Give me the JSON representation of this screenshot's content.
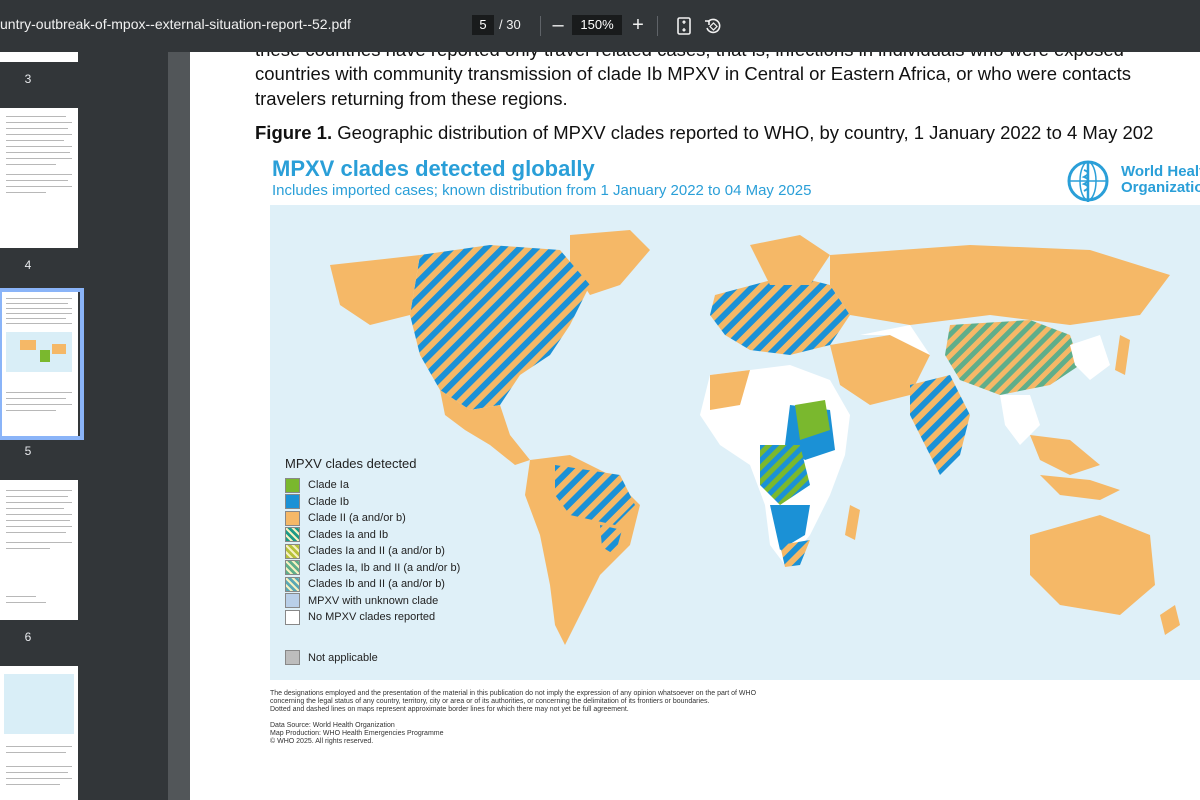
{
  "toolbar": {
    "file_title": "untry-outbreak-of-mpox--external-situation-report--52.pdf",
    "current_page": "5",
    "page_total": "/ 30",
    "zoom": "150%",
    "minus_label": "–",
    "plus_label": "+"
  },
  "sidebar": {
    "thumbnails": [
      {
        "label": "3"
      },
      {
        "label": "4"
      },
      {
        "label": "5"
      },
      {
        "label": "6"
      }
    ]
  },
  "document": {
    "line1": "these countries have reported only travel-related cases, that is, infections in individuals who were exposed",
    "line2": "countries with community transmission of clade Ib MPXV in Central or Eastern Africa, or who were contacts",
    "line3": "travelers returning from these regions.",
    "figure_label": "Figure 1.",
    "figure_caption": " Geographic distribution of MPXV clades reported to WHO, by country, 1 January 2022 to 4 May 202"
  },
  "map": {
    "title": "MPXV clades detected globally",
    "subtitle": "Includes imported cases; known distribution from 1 January 2022 to 04 May 2025",
    "who_line1": "World Health",
    "who_line2": "Organization",
    "legend_title": "MPXV clades detected",
    "legend": [
      {
        "label": "Clade Ia",
        "color": "#7ab82e"
      },
      {
        "label": "Clade Ib",
        "color": "#1b91d6"
      },
      {
        "label": "Clade II (a and/or b)",
        "color": "#f5b867"
      },
      {
        "label": "Clades Ia and Ib",
        "color": "#1d9a87"
      },
      {
        "label": "Clades Ia and II (a and/or b)",
        "color": "#b7c13a"
      },
      {
        "label": "Clades Ia, Ib and II (a and/or b)",
        "color": "#5fae8a"
      },
      {
        "label": "Clades Ib and II (a and/or b)",
        "color": "#5aa8b4"
      },
      {
        "label": "MPXV with unknown clade",
        "color": "#b9cfe8"
      },
      {
        "label": "No MPXV clades reported",
        "color": "#ffffff"
      }
    ],
    "not_applicable": {
      "label": "Not applicable",
      "color": "#bdbdbd"
    },
    "disclaimer": [
      "The designations employed and the presentation of the material in this publication do not imply the expression of any opinion whatsoever on the part of WHO",
      "concerning the legal status of any country, territory, city or area or of its authorities, or concerning the delimitation of its frontiers or boundaries.",
      "Dotted and dashed lines on maps represent approximate border lines for which there may not yet be full agreement.",
      "",
      "Data Source: World Health Organization",
      "Map Production: WHO Health Emergencies Programme",
      "© WHO 2025. All rights reserved."
    ]
  }
}
